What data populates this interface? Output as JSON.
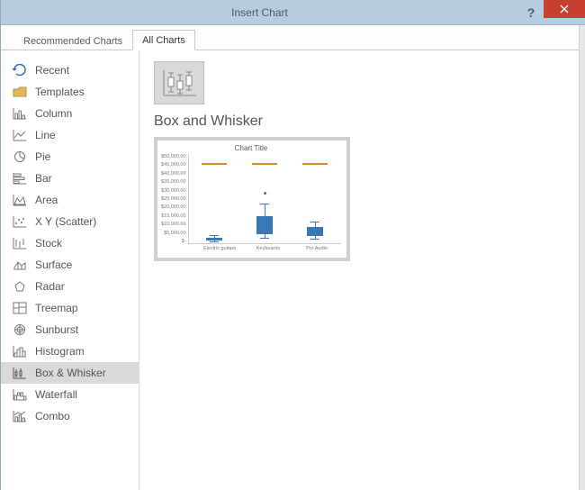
{
  "window": {
    "title": "Insert Chart"
  },
  "tabs": {
    "recommended": "Recommended Charts",
    "all": "All Charts"
  },
  "sidebar": [
    {
      "name": "recent",
      "label": "Recent"
    },
    {
      "name": "templates",
      "label": "Templates"
    },
    {
      "name": "column",
      "label": "Column"
    },
    {
      "name": "line",
      "label": "Line"
    },
    {
      "name": "pie",
      "label": "Pie"
    },
    {
      "name": "bar",
      "label": "Bar"
    },
    {
      "name": "area",
      "label": "Area"
    },
    {
      "name": "scatter",
      "label": "X Y (Scatter)"
    },
    {
      "name": "stock",
      "label": "Stock"
    },
    {
      "name": "surface",
      "label": "Surface"
    },
    {
      "name": "radar",
      "label": "Radar"
    },
    {
      "name": "treemap",
      "label": "Treemap"
    },
    {
      "name": "sunburst",
      "label": "Sunburst"
    },
    {
      "name": "histogram",
      "label": "Histogram"
    },
    {
      "name": "boxwhisker",
      "label": "Box & Whisker",
      "selected": true
    },
    {
      "name": "waterfall",
      "label": "Waterfall"
    },
    {
      "name": "combo",
      "label": "Combo"
    }
  ],
  "main": {
    "type_title": "Box and Whisker"
  },
  "chart_data": {
    "type": "boxwhisker",
    "title": "Chart Title",
    "ylabel": "",
    "ylim": [
      0,
      50000
    ],
    "yticks": [
      "$50,000.00",
      "$45,000.00",
      "$40,000.00",
      "$35,000.00",
      "$30,000.00",
      "$25,000.00",
      "$20,000.00",
      "$15,000.00",
      "$10,000.00",
      "$5,000.00",
      "$-"
    ],
    "categories": [
      "Electric guitars",
      "Keyboards",
      "Pro Audio"
    ],
    "reference_line": 45000,
    "series": [
      {
        "name": "Electric guitars",
        "q1": 1500,
        "median": 2200,
        "q3": 3000,
        "low": 800,
        "high": 4500
      },
      {
        "name": "Keyboards",
        "q1": 5000,
        "median": 9000,
        "q3": 15000,
        "low": 3000,
        "high": 22000,
        "outliers": [
          28000
        ]
      },
      {
        "name": "Pro Audio",
        "q1": 4000,
        "median": 6000,
        "q3": 9000,
        "low": 2500,
        "high": 12000
      }
    ]
  }
}
